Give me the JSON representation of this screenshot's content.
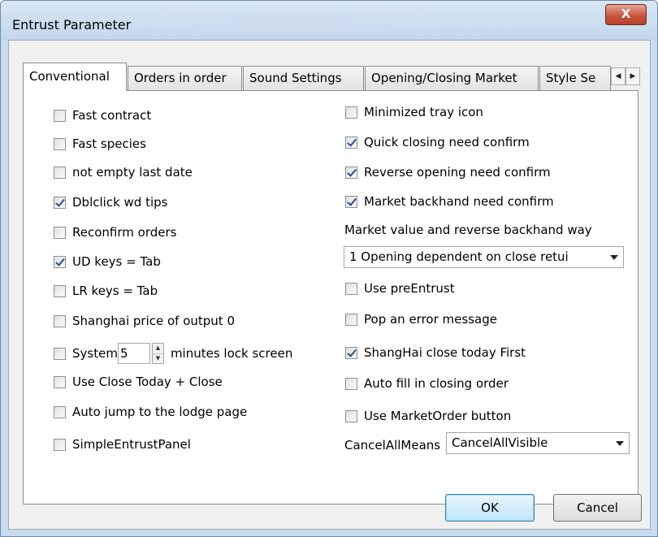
{
  "window": {
    "title": "Entrust Parameter",
    "close_label": "X"
  },
  "tabs": [
    {
      "label": "Conventional",
      "active": true
    },
    {
      "label": "Orders in order",
      "active": false
    },
    {
      "label": "Sound Settings",
      "active": false
    },
    {
      "label": "Opening/Closing Market",
      "active": false
    },
    {
      "label": "Style Se",
      "active": false
    }
  ],
  "tab_scroll": {
    "left": "◀",
    "right": "▶"
  },
  "left_options": [
    {
      "label": "Fast contract",
      "checked": false
    },
    {
      "label": "Fast species",
      "checked": false
    },
    {
      "label": "not empty last date",
      "checked": false
    },
    {
      "label": "Dblclick wd tips",
      "checked": true
    },
    {
      "label": "Reconfirm orders",
      "checked": false
    },
    {
      "label": "UD keys = Tab",
      "checked": true
    },
    {
      "label": "LR keys = Tab",
      "checked": false
    },
    {
      "label": "Shanghai price of output 0",
      "checked": false
    }
  ],
  "lock_screen": {
    "prefix": "System",
    "value": "5",
    "suffix": "minutes lock screen",
    "checked": false
  },
  "left_options_2": [
    {
      "label": "Use Close Today + Close",
      "checked": false
    },
    {
      "label": "Auto jump to the lodge page",
      "checked": false
    },
    {
      "label": "SimpleEntrustPanel",
      "checked": false
    }
  ],
  "right_options": [
    {
      "label": "Minimized tray icon",
      "checked": false
    },
    {
      "label": "Quick closing need confirm",
      "checked": true
    },
    {
      "label": "Reverse opening need confirm",
      "checked": true
    },
    {
      "label": "Market backhand need confirm",
      "checked": true
    }
  ],
  "backhand_way": {
    "label": "Market value and reverse backhand way",
    "selected": "1 Opening dependent on close retui"
  },
  "right_options_2": [
    {
      "label": "Use preEntrust",
      "checked": false
    },
    {
      "label": "Pop an error message",
      "checked": false
    },
    {
      "label": "ShangHai close today First",
      "checked": true
    },
    {
      "label": "Auto fill in closing order",
      "checked": false
    },
    {
      "label": "Use MarketOrder button",
      "checked": false
    }
  ],
  "cancel_all": {
    "label": "CancelAllMeans",
    "selected": "CancelAllVisible"
  },
  "buttons": {
    "ok": "OK",
    "cancel": "Cancel"
  }
}
